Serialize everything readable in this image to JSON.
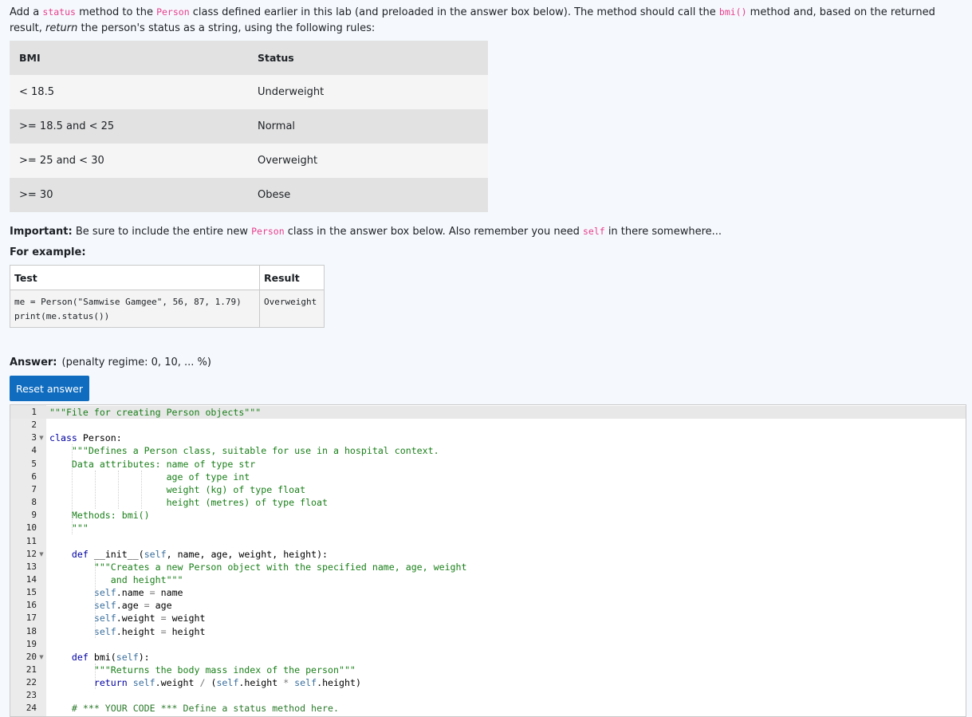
{
  "question": {
    "intro_1": "Add a ",
    "intro_status_code": "status",
    "intro_2": " method to the ",
    "intro_person_code": "Person",
    "intro_3": " class defined earlier in this lab (and preloaded in the answer box below). The method should call the ",
    "intro_bmi_code": "bmi()",
    "intro_4": " method and, based on the returned result, ",
    "intro_return_em": "return",
    "intro_5": " the person's status as a string, using the following rules:",
    "bmi_table": {
      "headers": [
        "BMI",
        "Status"
      ],
      "rows": [
        [
          "< 18.5",
          "Underweight"
        ],
        [
          ">= 18.5 and < 25",
          "Normal"
        ],
        [
          ">= 25 and < 30",
          "Overweight"
        ],
        [
          ">= 30",
          "Obese"
        ]
      ]
    },
    "important_label": "Important:",
    "important_1": " Be sure to include the entire new ",
    "important_person_code": "Person",
    "important_2": " class in the answer box below. Also remember you need ",
    "important_self_code": "self",
    "important_3": " in there somewhere...",
    "for_example": "For example:",
    "example_table": {
      "headers": [
        "Test",
        "Result"
      ],
      "test": "me = Person(\"Samwise Gamgee\", 56, 87, 1.79)\nprint(me.status())",
      "result": "Overweight"
    }
  },
  "answer": {
    "label": "Answer:",
    "penalty": "(penalty regime: 0, 10, ... %)",
    "reset_label": "Reset answer"
  },
  "editor": {
    "lines": [
      "\"\"\"File for creating Person objects\"\"\"",
      "",
      "class Person:",
      "    \"\"\"Defines a Person class, suitable for use in a hospital context.",
      "    Data attributes: name of type str",
      "                     age of type int",
      "                     weight (kg) of type float",
      "                     height (metres) of type float",
      "    Methods: bmi()",
      "    \"\"\"",
      "",
      "    def __init__(self, name, age, weight, height):",
      "        \"\"\"Creates a new Person object with the specified name, age, weight",
      "           and height\"\"\"",
      "        self.name = name",
      "        self.age = age",
      "        self.weight = weight",
      "        self.height = height",
      "",
      "    def bmi(self):",
      "        \"\"\"Returns the body mass index of the person\"\"\"",
      "        return self.weight / (self.height * self.height)",
      "",
      "    # *** YOUR CODE *** Define a status method here."
    ],
    "fold_lines": [
      3,
      12,
      20
    ]
  }
}
